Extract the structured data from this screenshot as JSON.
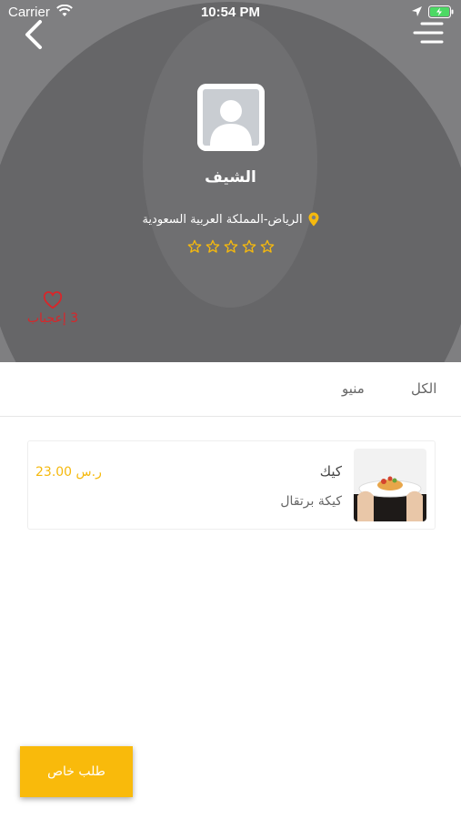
{
  "status_bar": {
    "carrier": "Carrier",
    "time": "10:54 PM",
    "wifi_icon": "wifi-icon",
    "location_icon": "location-arrow-icon",
    "battery_icon": "battery-charging-icon"
  },
  "header": {
    "back_icon": "chevron-left-icon",
    "menu_icon": "hamburger-menu-icon",
    "avatar_icon": "user-placeholder-icon",
    "chef_name": "الشيف",
    "location": "الرياض-المملكة العربية السعودية",
    "location_icon": "map-pin-icon",
    "rating": 0,
    "rating_max": 5,
    "likes": "3 إعجباب",
    "like_icon": "heart-icon",
    "colors": {
      "overlay": "#7f7f81",
      "silhouette": "#666668",
      "star": "#f5b90e",
      "like": "#d8262a"
    }
  },
  "tabs": [
    {
      "label": "الكل",
      "active": true
    },
    {
      "label": "منيو",
      "active": false
    }
  ],
  "items": [
    {
      "name": "كيك",
      "description": "كيكة برتقال",
      "price": "23.00 ر.س",
      "image_icon": "dish-photo"
    }
  ],
  "special_order_button": {
    "label": "طلب خاص",
    "color": "#f9ba0b"
  }
}
